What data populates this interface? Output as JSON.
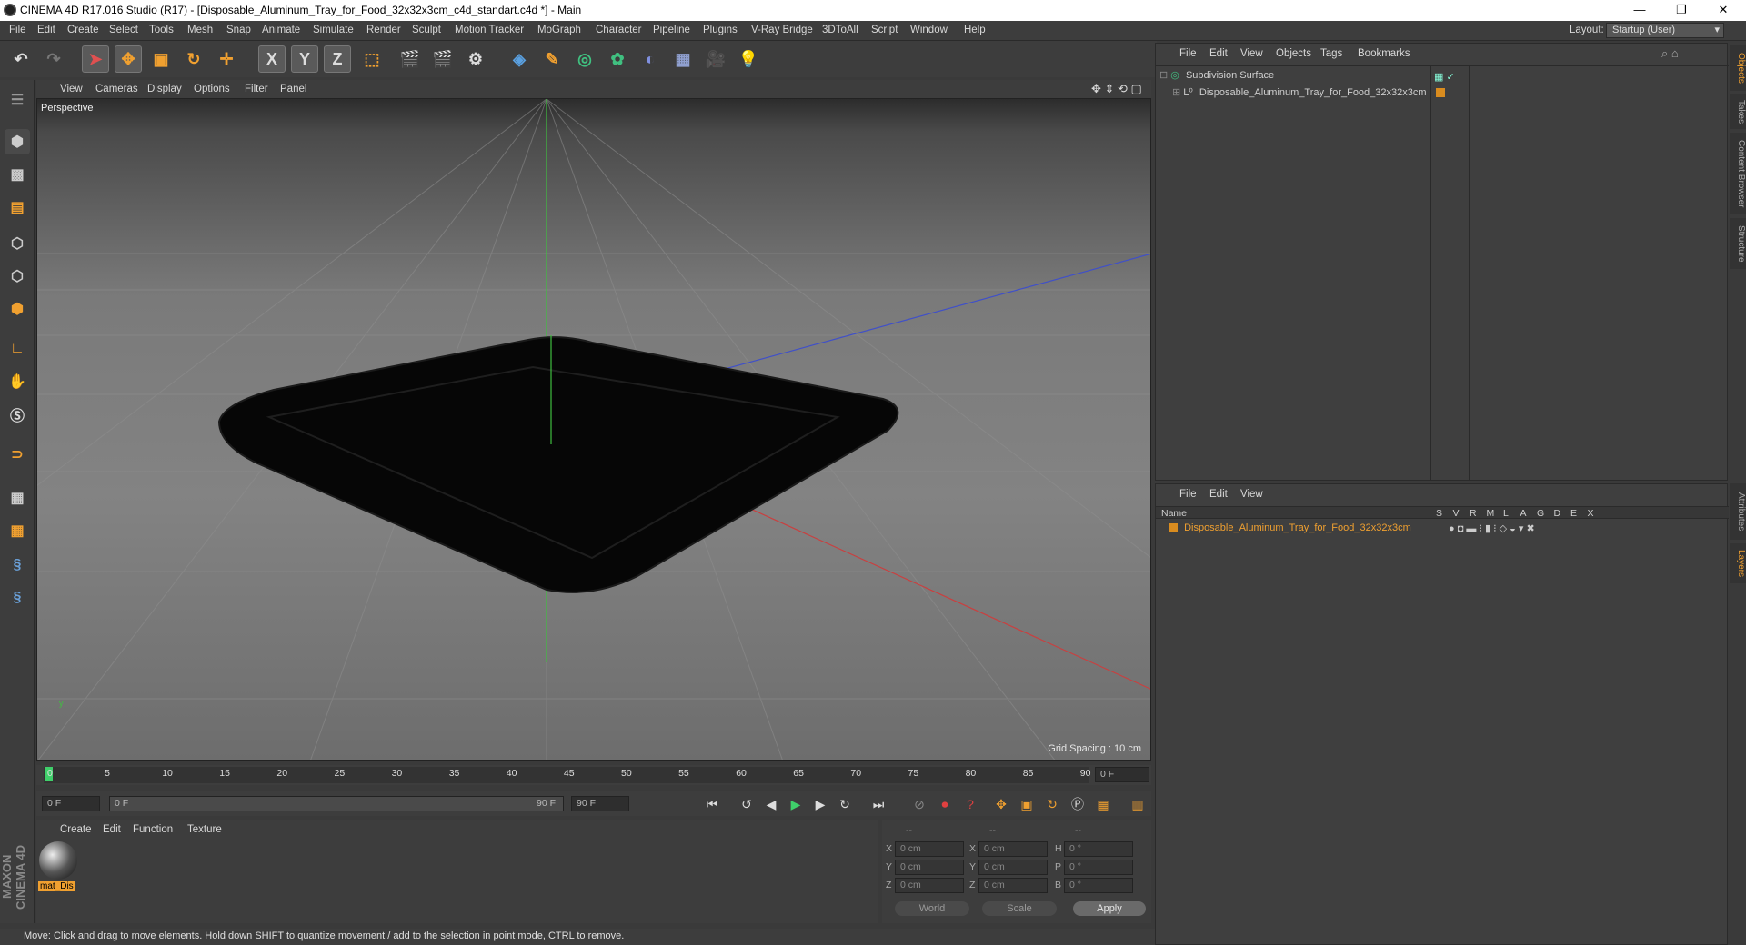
{
  "window": {
    "title": "CINEMA 4D R17.016 Studio (R17) - [Disposable_Aluminum_Tray_for_Food_32x32x3cm_c4d_standart.c4d *] - Main",
    "controls": [
      "—",
      "❐",
      "✕"
    ]
  },
  "menubar": {
    "items": [
      "File",
      "Edit",
      "Create",
      "Select",
      "Tools",
      "Mesh",
      "Snap",
      "Animate",
      "Simulate",
      "Render",
      "Sculpt",
      "Motion Tracker",
      "MoGraph",
      "Character",
      "Pipeline",
      "Plugins",
      "V-Ray Bridge",
      "3DToAll",
      "Script",
      "Window",
      "Help"
    ],
    "layout_label": "Layout:",
    "layout_value": "Startup (User)"
  },
  "toolbar": {
    "icons": [
      "undo-icon",
      "redo-icon",
      "select-arrow-icon",
      "move-icon",
      "scale-icon",
      "rotate-icon",
      "move-plus-icon",
      "x-axis-icon",
      "y-axis-icon",
      "z-axis-icon",
      "world-coord-icon",
      "render-view-icon",
      "render-picture-icon",
      "render-settings-icon",
      "cube-icon",
      "pen-icon",
      "subdivision-icon",
      "array-icon",
      "deformer-icon",
      "floor-icon",
      "camera-icon",
      "light-icon"
    ],
    "axis_labels": [
      "X",
      "Y",
      "Z"
    ]
  },
  "viewport": {
    "menu": [
      "View",
      "Cameras",
      "Display",
      "Options",
      "Filter",
      "Panel"
    ],
    "label": "Perspective",
    "grid_spacing": "Grid Spacing : 10 cm"
  },
  "timeline": {
    "ticks": [
      "0",
      "5",
      "10",
      "15",
      "20",
      "25",
      "30",
      "35",
      "40",
      "45",
      "50",
      "55",
      "60",
      "65",
      "70",
      "75",
      "80",
      "85",
      "90"
    ],
    "current_frame": "0 F"
  },
  "transport": {
    "start": "0 F",
    "range_start": "0 F",
    "range_end": "90 F",
    "end": "90 F"
  },
  "material_panel": {
    "menu": [
      "Create",
      "Edit",
      "Function",
      "Texture"
    ],
    "material_name": "mat_Dis"
  },
  "coord_panel": {
    "headers": [
      "--",
      "--",
      "--"
    ],
    "rows": [
      {
        "a": "X",
        "av": "0 cm",
        "b": "X",
        "bv": "0 cm",
        "c": "H",
        "cv": "0 °"
      },
      {
        "a": "Y",
        "av": "0 cm",
        "b": "Y",
        "bv": "0 cm",
        "c": "P",
        "cv": "0 °"
      },
      {
        "a": "Z",
        "av": "0 cm",
        "b": "Z",
        "bv": "0 cm",
        "c": "B",
        "cv": "0 °"
      }
    ],
    "world": "World",
    "scale": "Scale",
    "apply": "Apply"
  },
  "object_manager": {
    "menu": [
      "File",
      "Edit",
      "View",
      "Objects",
      "Tags",
      "Bookmarks"
    ],
    "objects": [
      {
        "name": "Subdivision Surface"
      },
      {
        "name": "Disposable_Aluminum_Tray_for_Food_32x32x3cm"
      }
    ]
  },
  "layer_manager": {
    "menu": [
      "File",
      "Edit",
      "View"
    ],
    "name_header": "Name",
    "col_headers": [
      "S",
      "V",
      "R",
      "M",
      "L",
      "A",
      "G",
      "D",
      "E",
      "X"
    ],
    "layer_name": "Disposable_Aluminum_Tray_for_Food_32x32x3cm"
  },
  "side_tabs": [
    "Objects",
    "Takes",
    "Content Browser",
    "Structure",
    "Attributes",
    "Layers"
  ],
  "status": "Move: Click and drag to move elements. Hold down SHIFT to quantize movement / add to the selection in point mode, CTRL to remove.",
  "brand": "MAXON CINEMA 4D",
  "colors": {
    "accent": "#f0a030",
    "selected_orange": "#d98c1f",
    "x_axis": "#c84040",
    "y_axis": "#40b040",
    "z_axis": "#4050c8"
  }
}
